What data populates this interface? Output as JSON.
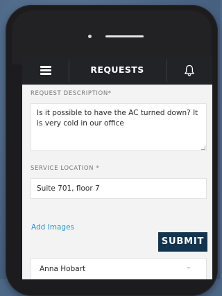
{
  "app_bar": {
    "title": "REQUESTS",
    "menu_icon": "hamburger-menu-icon",
    "notification_icon": "bell-icon"
  },
  "form": {
    "request_description": {
      "label": "REQUEST DESCRIPTION*",
      "value": "Is it possible to have the AC turned down? It is very cold in our office"
    },
    "service_location": {
      "label": "SERVICE LOCATION *",
      "value": "Suite 701, floor 7"
    },
    "add_images_label": "Add Images",
    "submit_label": "SUBMIT",
    "requester": {
      "selected": "Anna Hobart"
    }
  },
  "colors": {
    "background": "#4d6887",
    "app_bar": "#222326",
    "submit_button": "#13344f",
    "link": "#2f93c4"
  }
}
